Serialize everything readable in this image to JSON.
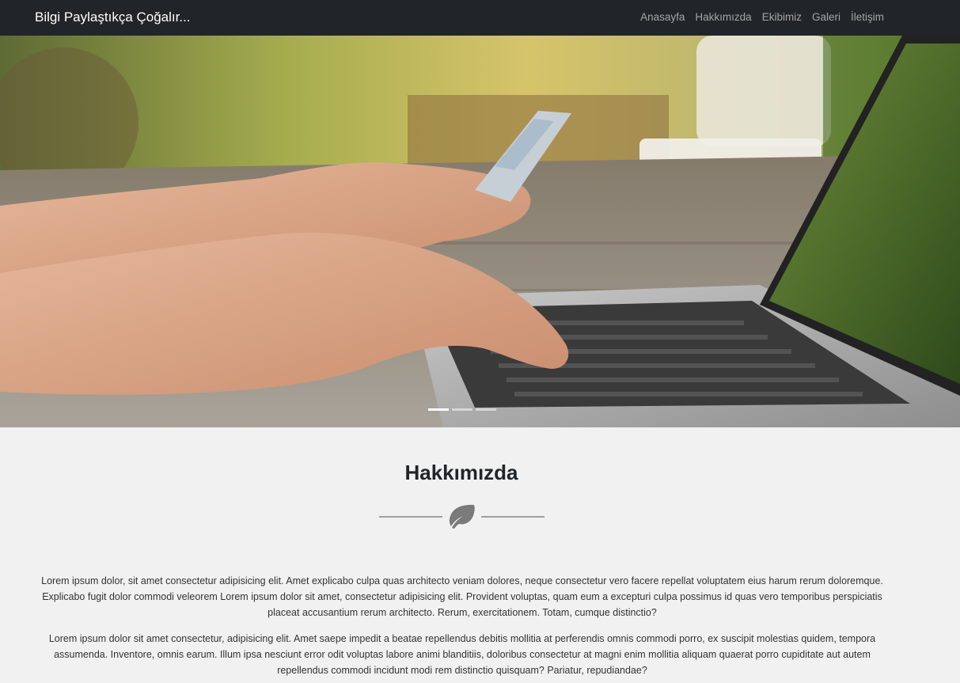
{
  "navbar": {
    "brand": "Bilgi Paylaştıkça Çoğalır...",
    "links": [
      "Anasayfa",
      "Hakkımızda",
      "Ekibimiz",
      "Galeri",
      "İletişim"
    ]
  },
  "hero": {
    "slides_count": 3,
    "active_slide": 1
  },
  "about": {
    "title": "Hakkımızda",
    "icon": "leaf-icon",
    "paragraphs": [
      "Lorem ipsum dolor, sit amet consectetur adipisicing elit. Amet explicabo culpa quas architecto veniam dolores, neque consectetur vero facere repellat voluptatem eius harum rerum doloremque. Explicabo fugit dolor commodi veleorem Lorem ipsum dolor sit amet, consectetur adipisicing elit. Provident voluptas, quam eum a excepturi culpa possimus id quas vero temporibus perspiciatis placeat accusantium rerum architecto. Rerum, exercitationem. Totam, cumque distinctio?",
      "Lorem ipsum dolor sit amet consectetur, adipisicing elit. Amet saepe impedit a beatae repellendus debitis mollitia at perferendis omnis commodi porro, ex suscipit molestias quidem, tempora assumenda. Inventore, omnis earum. Illum ipsa nesciunt error odit voluptas labore animi blanditiis, doloribus consectetur at magni enim mollitia aliquam quaerat porro cupiditate aut autem repellendus commodi incidunt modi rem distinctio quisquam? Pariatur, repudiandae?"
    ]
  },
  "colors": {
    "navbar_bg": "#212529",
    "page_bg": "#f1f1f1",
    "accent_gray": "#7a7a7a"
  }
}
